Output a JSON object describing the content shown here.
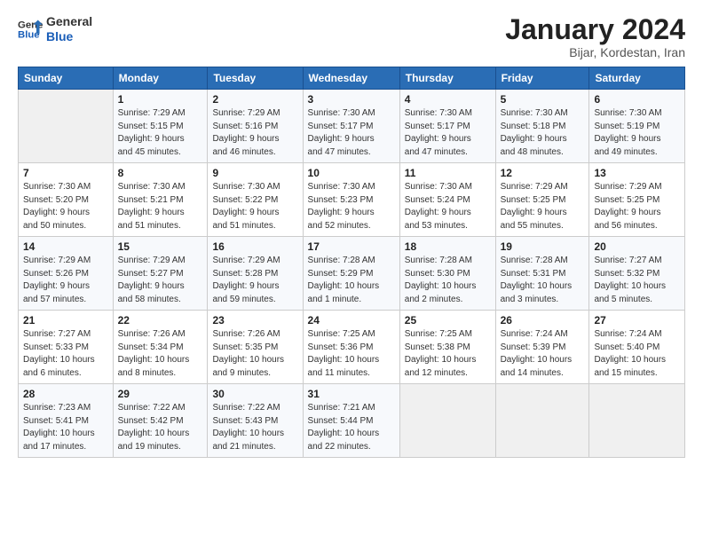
{
  "header": {
    "logo_line1": "General",
    "logo_line2": "Blue",
    "month": "January 2024",
    "location": "Bijar, Kordestan, Iran"
  },
  "weekdays": [
    "Sunday",
    "Monday",
    "Tuesday",
    "Wednesday",
    "Thursday",
    "Friday",
    "Saturday"
  ],
  "weeks": [
    [
      {
        "day": "",
        "info": ""
      },
      {
        "day": "1",
        "info": "Sunrise: 7:29 AM\nSunset: 5:15 PM\nDaylight: 9 hours\nand 45 minutes."
      },
      {
        "day": "2",
        "info": "Sunrise: 7:29 AM\nSunset: 5:16 PM\nDaylight: 9 hours\nand 46 minutes."
      },
      {
        "day": "3",
        "info": "Sunrise: 7:30 AM\nSunset: 5:17 PM\nDaylight: 9 hours\nand 47 minutes."
      },
      {
        "day": "4",
        "info": "Sunrise: 7:30 AM\nSunset: 5:17 PM\nDaylight: 9 hours\nand 47 minutes."
      },
      {
        "day": "5",
        "info": "Sunrise: 7:30 AM\nSunset: 5:18 PM\nDaylight: 9 hours\nand 48 minutes."
      },
      {
        "day": "6",
        "info": "Sunrise: 7:30 AM\nSunset: 5:19 PM\nDaylight: 9 hours\nand 49 minutes."
      }
    ],
    [
      {
        "day": "7",
        "info": "Sunrise: 7:30 AM\nSunset: 5:20 PM\nDaylight: 9 hours\nand 50 minutes."
      },
      {
        "day": "8",
        "info": "Sunrise: 7:30 AM\nSunset: 5:21 PM\nDaylight: 9 hours\nand 51 minutes."
      },
      {
        "day": "9",
        "info": "Sunrise: 7:30 AM\nSunset: 5:22 PM\nDaylight: 9 hours\nand 51 minutes."
      },
      {
        "day": "10",
        "info": "Sunrise: 7:30 AM\nSunset: 5:23 PM\nDaylight: 9 hours\nand 52 minutes."
      },
      {
        "day": "11",
        "info": "Sunrise: 7:30 AM\nSunset: 5:24 PM\nDaylight: 9 hours\nand 53 minutes."
      },
      {
        "day": "12",
        "info": "Sunrise: 7:29 AM\nSunset: 5:25 PM\nDaylight: 9 hours\nand 55 minutes."
      },
      {
        "day": "13",
        "info": "Sunrise: 7:29 AM\nSunset: 5:25 PM\nDaylight: 9 hours\nand 56 minutes."
      }
    ],
    [
      {
        "day": "14",
        "info": "Sunrise: 7:29 AM\nSunset: 5:26 PM\nDaylight: 9 hours\nand 57 minutes."
      },
      {
        "day": "15",
        "info": "Sunrise: 7:29 AM\nSunset: 5:27 PM\nDaylight: 9 hours\nand 58 minutes."
      },
      {
        "day": "16",
        "info": "Sunrise: 7:29 AM\nSunset: 5:28 PM\nDaylight: 9 hours\nand 59 minutes."
      },
      {
        "day": "17",
        "info": "Sunrise: 7:28 AM\nSunset: 5:29 PM\nDaylight: 10 hours\nand 1 minute."
      },
      {
        "day": "18",
        "info": "Sunrise: 7:28 AM\nSunset: 5:30 PM\nDaylight: 10 hours\nand 2 minutes."
      },
      {
        "day": "19",
        "info": "Sunrise: 7:28 AM\nSunset: 5:31 PM\nDaylight: 10 hours\nand 3 minutes."
      },
      {
        "day": "20",
        "info": "Sunrise: 7:27 AM\nSunset: 5:32 PM\nDaylight: 10 hours\nand 5 minutes."
      }
    ],
    [
      {
        "day": "21",
        "info": "Sunrise: 7:27 AM\nSunset: 5:33 PM\nDaylight: 10 hours\nand 6 minutes."
      },
      {
        "day": "22",
        "info": "Sunrise: 7:26 AM\nSunset: 5:34 PM\nDaylight: 10 hours\nand 8 minutes."
      },
      {
        "day": "23",
        "info": "Sunrise: 7:26 AM\nSunset: 5:35 PM\nDaylight: 10 hours\nand 9 minutes."
      },
      {
        "day": "24",
        "info": "Sunrise: 7:25 AM\nSunset: 5:36 PM\nDaylight: 10 hours\nand 11 minutes."
      },
      {
        "day": "25",
        "info": "Sunrise: 7:25 AM\nSunset: 5:38 PM\nDaylight: 10 hours\nand 12 minutes."
      },
      {
        "day": "26",
        "info": "Sunrise: 7:24 AM\nSunset: 5:39 PM\nDaylight: 10 hours\nand 14 minutes."
      },
      {
        "day": "27",
        "info": "Sunrise: 7:24 AM\nSunset: 5:40 PM\nDaylight: 10 hours\nand 15 minutes."
      }
    ],
    [
      {
        "day": "28",
        "info": "Sunrise: 7:23 AM\nSunset: 5:41 PM\nDaylight: 10 hours\nand 17 minutes."
      },
      {
        "day": "29",
        "info": "Sunrise: 7:22 AM\nSunset: 5:42 PM\nDaylight: 10 hours\nand 19 minutes."
      },
      {
        "day": "30",
        "info": "Sunrise: 7:22 AM\nSunset: 5:43 PM\nDaylight: 10 hours\nand 21 minutes."
      },
      {
        "day": "31",
        "info": "Sunrise: 7:21 AM\nSunset: 5:44 PM\nDaylight: 10 hours\nand 22 minutes."
      },
      {
        "day": "",
        "info": ""
      },
      {
        "day": "",
        "info": ""
      },
      {
        "day": "",
        "info": ""
      }
    ]
  ]
}
